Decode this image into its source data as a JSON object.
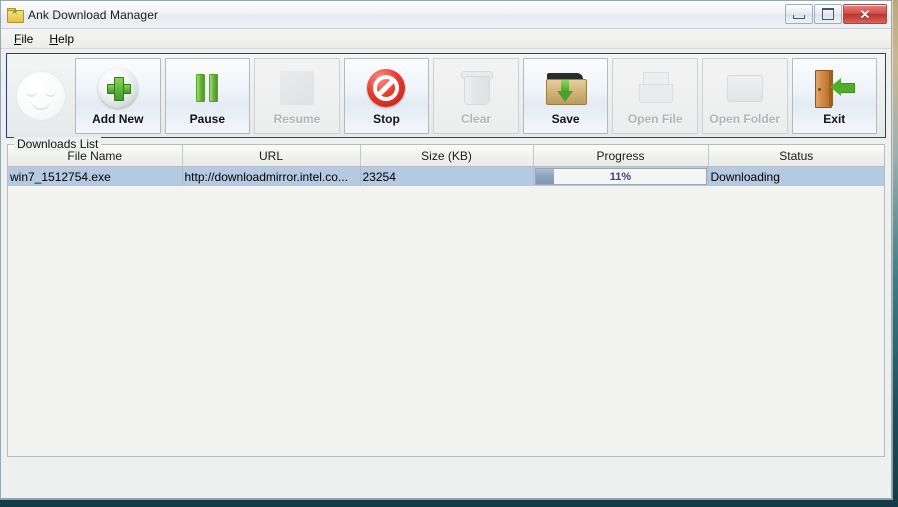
{
  "window": {
    "title": "Ank Download Manager",
    "icon": "folder-icon",
    "controls": {
      "minimize": "–",
      "maximize": "▢",
      "close": "✕"
    }
  },
  "menubar": {
    "items": [
      {
        "label": "File",
        "mnemonic": "F"
      },
      {
        "label": "Help",
        "mnemonic": "H"
      }
    ]
  },
  "toolbar": {
    "logo": "smiley-logo",
    "buttons": [
      {
        "label": "Add New",
        "icon": "add-plus-icon",
        "enabled": true
      },
      {
        "label": "Pause",
        "icon": "pause-icon",
        "enabled": true
      },
      {
        "label": "Resume",
        "icon": "resume-icon",
        "enabled": false
      },
      {
        "label": "Stop",
        "icon": "stop-icon",
        "enabled": true
      },
      {
        "label": "Clear",
        "icon": "trash-icon",
        "enabled": false
      },
      {
        "label": "Save",
        "icon": "save-folder-icon",
        "enabled": true
      },
      {
        "label": "Open File",
        "icon": "document-icon",
        "enabled": false
      },
      {
        "label": "Open Folder",
        "icon": "folder-icon",
        "enabled": false
      },
      {
        "label": "Exit",
        "icon": "exit-door-icon",
        "enabled": true
      }
    ]
  },
  "downloads": {
    "group_title": "Downloads List",
    "columns": [
      "File Name",
      "URL",
      "Size (KB)",
      "Progress",
      "Status"
    ],
    "rows": [
      {
        "file_name": "win7_1512754.exe",
        "url": "http://downloadmirror.intel.co...",
        "size_kb": "23254",
        "progress_percent": 11,
        "progress_label": "11%",
        "status": "Downloading",
        "selected": true
      }
    ]
  },
  "colors": {
    "toolbar_border": "#2b3b8f",
    "selection": "#b4cae2",
    "progress_fill": "#8ba3bf",
    "progress_text": "#40407f",
    "close_button": "#c21d14"
  }
}
